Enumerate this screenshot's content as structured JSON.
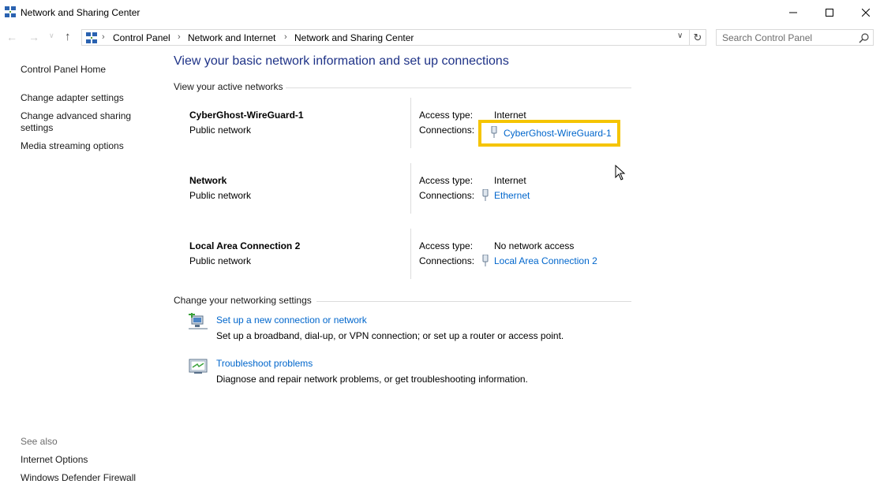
{
  "window": {
    "title": "Network and Sharing Center"
  },
  "address": {
    "breadcrumbs": [
      "Control Panel",
      "Network and Internet",
      "Network and Sharing Center"
    ],
    "search_placeholder": "Search Control Panel"
  },
  "left_pane": {
    "links": [
      "Control Panel Home",
      "Change adapter settings",
      "Change advanced sharing settings",
      "Media streaming options"
    ],
    "see_also_label": "See also",
    "see_also_links": [
      "Internet Options",
      "Windows Defender Firewall"
    ]
  },
  "main": {
    "title": "View your basic network information and set up connections",
    "active_networks_label": "View your active networks",
    "networks": [
      {
        "name": "CyberGhost-WireGuard-1",
        "type": "Public network",
        "access_label": "Access type:",
        "access": "Internet",
        "connections_label": "Connections:",
        "connection": "CyberGhost-WireGuard-1"
      },
      {
        "name": "Network",
        "type": "Public network",
        "access_label": "Access type:",
        "access": "Internet",
        "connections_label": "Connections:",
        "connection": "Ethernet"
      },
      {
        "name": "Local Area Connection 2",
        "type": "Public network",
        "access_label": "Access type:",
        "access": "No network access",
        "connections_label": "Connections:",
        "connection": "Local Area Connection 2"
      }
    ],
    "change_settings_label": "Change your networking settings",
    "tasks": [
      {
        "link": "Set up a new connection or network",
        "description": "Set up a broadband, dial-up, or VPN connection; or set up a router or access point."
      },
      {
        "link": "Troubleshoot problems",
        "description": "Diagnose and repair network problems, or get troubleshooting information."
      }
    ]
  },
  "colors": {
    "link": "#0066cc",
    "title": "#1e3287",
    "highlight": "#f5c400"
  },
  "icons": [
    "network-center-icon",
    "back-arrow-icon",
    "forward-arrow-icon",
    "up-arrow-icon",
    "refresh-icon",
    "search-icon",
    "network-adapter-icon",
    "new-connection-icon",
    "troubleshoot-icon",
    "mouse-cursor-icon"
  ]
}
